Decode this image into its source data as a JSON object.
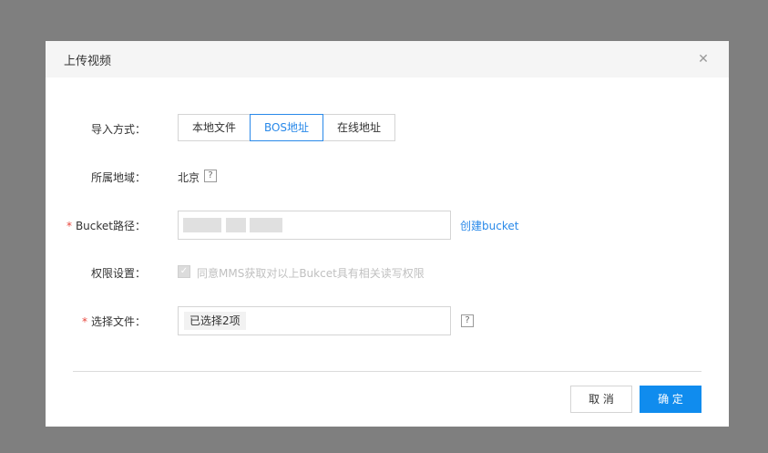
{
  "dialog": {
    "title": "上传视频",
    "close_icon": "close-icon"
  },
  "form": {
    "import_method": {
      "label": "导入方式：",
      "options": [
        "本地文件",
        "BOS地址",
        "在线地址"
      ],
      "selected": "BOS地址"
    },
    "region": {
      "label": "所属地域：",
      "value": "北京",
      "help": "?"
    },
    "bucket_path": {
      "required_mark": "*",
      "label": "Bucket路径：",
      "value": "",
      "create_link": "创建bucket"
    },
    "permission": {
      "label": "权限设置：",
      "checkbox_checked": true,
      "checkbox_mark": "✓",
      "checkbox_label": "同意MMS获取对以上Bukcet具有相关读写权限"
    },
    "select_file": {
      "required_mark": "*",
      "label": "选择文件：",
      "tag": "已选择2项",
      "help": "?"
    }
  },
  "footer": {
    "cancel_label": "取 消",
    "confirm_label": "确 定"
  },
  "colors": {
    "accent": "#108cee",
    "link": "#2989e9",
    "required": "#e8463c",
    "overlay": "#7f7f7f"
  }
}
